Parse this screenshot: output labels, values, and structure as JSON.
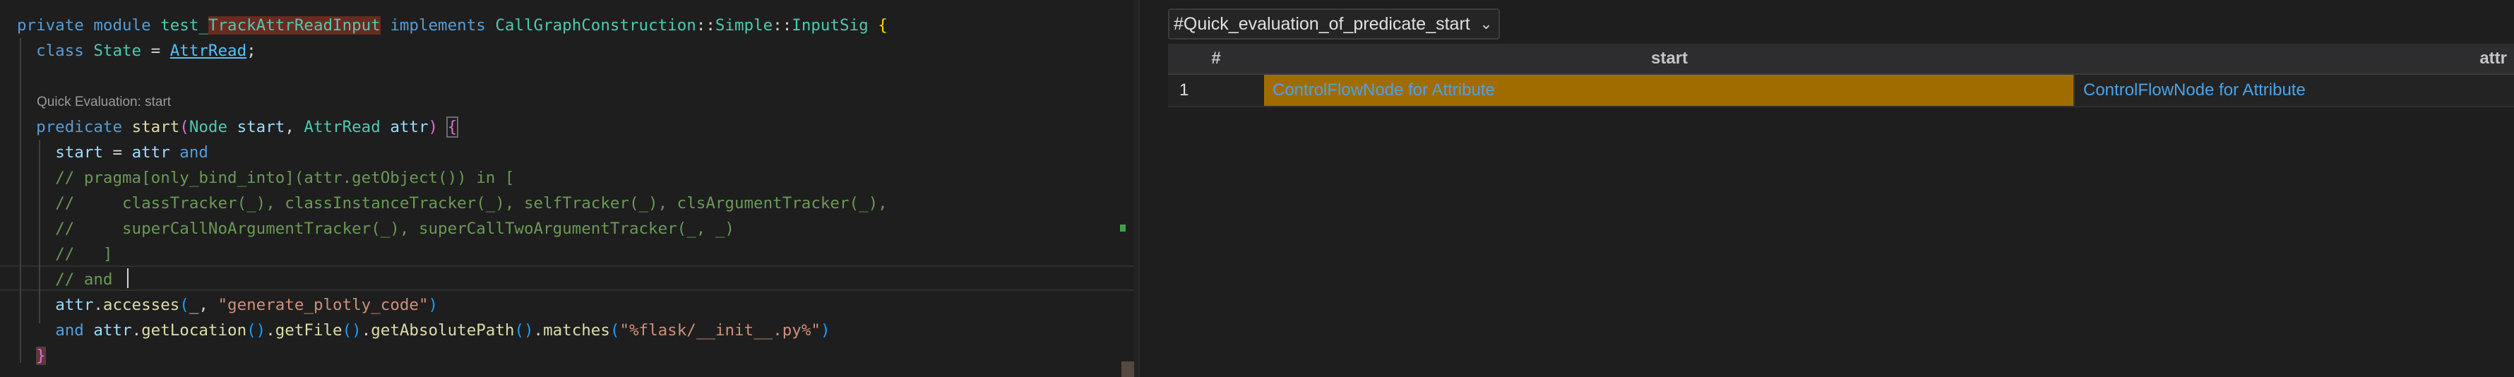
{
  "editor": {
    "lines": [
      [
        {
          "c": "kw",
          "t": "private"
        },
        {
          "c": "punc",
          "t": " "
        },
        {
          "c": "kw",
          "t": "module"
        },
        {
          "c": "punc",
          "t": " "
        },
        {
          "c": "ty",
          "t": "test_"
        },
        {
          "c": "hl-word",
          "t": "TrackAttrReadInput"
        },
        {
          "c": "punc",
          "t": " "
        },
        {
          "c": "kw",
          "t": "implements"
        },
        {
          "c": "punc",
          "t": " "
        },
        {
          "c": "ty",
          "t": "CallGraphConstruction"
        },
        {
          "c": "punc",
          "t": "::"
        },
        {
          "c": "ty",
          "t": "Simple"
        },
        {
          "c": "punc",
          "t": "::"
        },
        {
          "c": "ty",
          "t": "InputSig"
        },
        {
          "c": "punc",
          "t": " "
        },
        {
          "c": "brk1",
          "t": "{"
        }
      ],
      [
        {
          "c": "ind",
          "t": "  "
        },
        {
          "c": "kw",
          "t": "class"
        },
        {
          "c": "punc",
          "t": " "
        },
        {
          "c": "ty",
          "t": "State"
        },
        {
          "c": "punc",
          "t": " = "
        },
        {
          "c": "ty-link",
          "t": "AttrRead"
        },
        {
          "c": "punc",
          "t": ";"
        }
      ],
      [],
      [],
      [
        {
          "c": "ind",
          "t": "  "
        },
        {
          "c": "kw",
          "t": "predicate"
        },
        {
          "c": "punc",
          "t": " "
        },
        {
          "c": "fn",
          "t": "start"
        },
        {
          "c": "brk2",
          "t": "("
        },
        {
          "c": "ty",
          "t": "Node"
        },
        {
          "c": "punc",
          "t": " "
        },
        {
          "c": "var",
          "t": "start"
        },
        {
          "c": "punc",
          "t": ", "
        },
        {
          "c": "ty",
          "t": "AttrRead"
        },
        {
          "c": "punc",
          "t": " "
        },
        {
          "c": "var",
          "t": "attr"
        },
        {
          "c": "brk2",
          "t": ")"
        },
        {
          "c": "punc",
          "t": " "
        },
        {
          "c": "brk2 box-brace",
          "t": "{"
        }
      ],
      [
        {
          "c": "ind",
          "t": "    "
        },
        {
          "c": "var",
          "t": "start"
        },
        {
          "c": "punc",
          "t": " = "
        },
        {
          "c": "var",
          "t": "attr"
        },
        {
          "c": "punc",
          "t": " "
        },
        {
          "c": "kw",
          "t": "and"
        }
      ],
      [
        {
          "c": "ind",
          "t": "    "
        },
        {
          "c": "cmt",
          "t": "// pragma[only_bind_into](attr.getObject()) in ["
        }
      ],
      [
        {
          "c": "ind",
          "t": "    "
        },
        {
          "c": "cmt",
          "t": "//     classTracker(_), classInstanceTracker(_), selfTracker(_), clsArgumentTracker(_),"
        }
      ],
      [
        {
          "c": "ind",
          "t": "    "
        },
        {
          "c": "cmt",
          "t": "//     superCallNoArgumentTracker(_), superCallTwoArgumentTracker(_, _)"
        }
      ],
      [
        {
          "c": "ind",
          "t": "    "
        },
        {
          "c": "cmt",
          "t": "//   ]"
        }
      ],
      [
        {
          "c": "ind",
          "t": "    "
        },
        {
          "c": "cmt",
          "t": "// and "
        }
      ],
      [
        {
          "c": "ind",
          "t": "    "
        },
        {
          "c": "var",
          "t": "attr"
        },
        {
          "c": "punc",
          "t": "."
        },
        {
          "c": "fn",
          "t": "accesses"
        },
        {
          "c": "brk3",
          "t": "("
        },
        {
          "c": "punc",
          "t": "_, "
        },
        {
          "c": "str",
          "t": "\"generate_plotly_code\""
        },
        {
          "c": "brk3",
          "t": ")"
        }
      ],
      [
        {
          "c": "ind",
          "t": "    "
        },
        {
          "c": "kw",
          "t": "and"
        },
        {
          "c": "punc",
          "t": " "
        },
        {
          "c": "var",
          "t": "attr"
        },
        {
          "c": "punc",
          "t": "."
        },
        {
          "c": "fn",
          "t": "getLocation"
        },
        {
          "c": "brk3",
          "t": "()"
        },
        {
          "c": "punc",
          "t": "."
        },
        {
          "c": "fn",
          "t": "getFile"
        },
        {
          "c": "brk3",
          "t": "()"
        },
        {
          "c": "punc",
          "t": "."
        },
        {
          "c": "fn",
          "t": "getAbsolutePath"
        },
        {
          "c": "brk3",
          "t": "()"
        },
        {
          "c": "punc",
          "t": "."
        },
        {
          "c": "fn",
          "t": "matches"
        },
        {
          "c": "brk3",
          "t": "("
        },
        {
          "c": "str",
          "t": "\"%flask/__init__.py%\""
        },
        {
          "c": "brk3",
          "t": ")"
        }
      ],
      [
        {
          "c": "ind",
          "t": "  "
        },
        {
          "c": "brk2 box-brace2",
          "t": "}"
        }
      ]
    ],
    "code_lens": "Quick Evaluation: start"
  },
  "results": {
    "selector_label": "#Quick_evaluation_of_predicate_start",
    "columns": [
      "#",
      "start",
      "attr"
    ],
    "rows": [
      {
        "index": "1",
        "start": "ControlFlowNode for Attribute",
        "attr": "ControlFlowNode for Attribute"
      }
    ]
  },
  "colors": {
    "editor_bg": "#1e1e1e",
    "keyword": "#569cd6",
    "type": "#4ec9b0",
    "comment": "#6a9955",
    "string": "#ce9178",
    "highlight_cell": "#a06c00",
    "link": "#4aa3e8"
  }
}
